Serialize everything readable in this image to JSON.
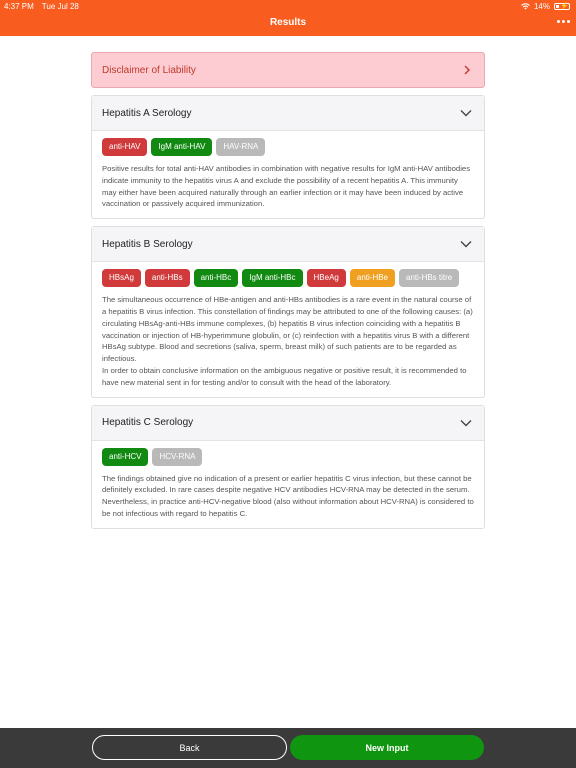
{
  "status_bar": {
    "time": "4:37 PM",
    "date": "Tue Jul 28",
    "battery": "14%"
  },
  "header": {
    "title": "Results"
  },
  "disclaimer": {
    "label": "Disclaimer of Liability"
  },
  "sections": [
    {
      "title": "Hepatitis A Serology",
      "tags": [
        {
          "label": "anti-HAV",
          "color": "#d13a3a"
        },
        {
          "label": "IgM anti-HAV",
          "color": "#128a12"
        },
        {
          "label": "HAV-RNA",
          "color": "#b9b9b9"
        }
      ],
      "paragraphs": [
        "Positive results for total anti-HAV antibodies in combination with negative results for IgM anti-HAV antibodies indicate immunity to the hepatitis virus A and exclude the possibility of a recent hepatitis A. This immunity may either have been acquired naturally through an earlier infection or it may have been induced by active vaccination or passively acquired immunization."
      ]
    },
    {
      "title": "Hepatitis B Serology",
      "tags": [
        {
          "label": "HBsAg",
          "color": "#d13a3a"
        },
        {
          "label": "anti-HBs",
          "color": "#d13a3a"
        },
        {
          "label": "anti-HBc",
          "color": "#128a12"
        },
        {
          "label": "IgM anti-HBc",
          "color": "#128a12"
        },
        {
          "label": "HBeAg",
          "color": "#d13a3a"
        },
        {
          "label": "anti-HBe",
          "color": "#f0a020"
        },
        {
          "label": "anti-HBs titre",
          "color": "#b9b9b9"
        }
      ],
      "paragraphs": [
        "The simultaneous occurrence of HBe-antigen and anti-HBs antibodies is a rare event in the natural course of a hepatitis B virus infection. This constellation of findings may be attributed to one of the following causes: (a) circulating HBsAg-anti-HBs immune complexes, (b) hepatitis B virus infection coinciding with a hepatitis B vaccination or injection of HB-hyperimmune globulin, or (c) reinfection with a hepatitis virus B with a different HBsAg subtype. Blood and secretions (saliva, sperm, breast milk) of such patients are to be regarded as infectious.",
        "In order to obtain conclusive information on the ambiguous negative or positive result, it is recommended to have new material sent in for testing and/or to consult with the head of the laboratory."
      ]
    },
    {
      "title": "Hepatitis C Serology",
      "tags": [
        {
          "label": "anti-HCV",
          "color": "#128a12"
        },
        {
          "label": "HCV-RNA",
          "color": "#b9b9b9"
        }
      ],
      "paragraphs": [
        "The findings obtained give no indication of a present or earlier hepatitis C virus infection, but these cannot be definitely excluded. In rare cases despite negative HCV antibodies HCV-RNA may be detected in the serum. Nevertheless, in practice anti-HCV-negative blood (also without information about HCV-RNA) is considered to be not infectious with regard to hepatitis C."
      ]
    }
  ],
  "footer": {
    "back_label": "Back",
    "new_input_label": "New Input"
  }
}
